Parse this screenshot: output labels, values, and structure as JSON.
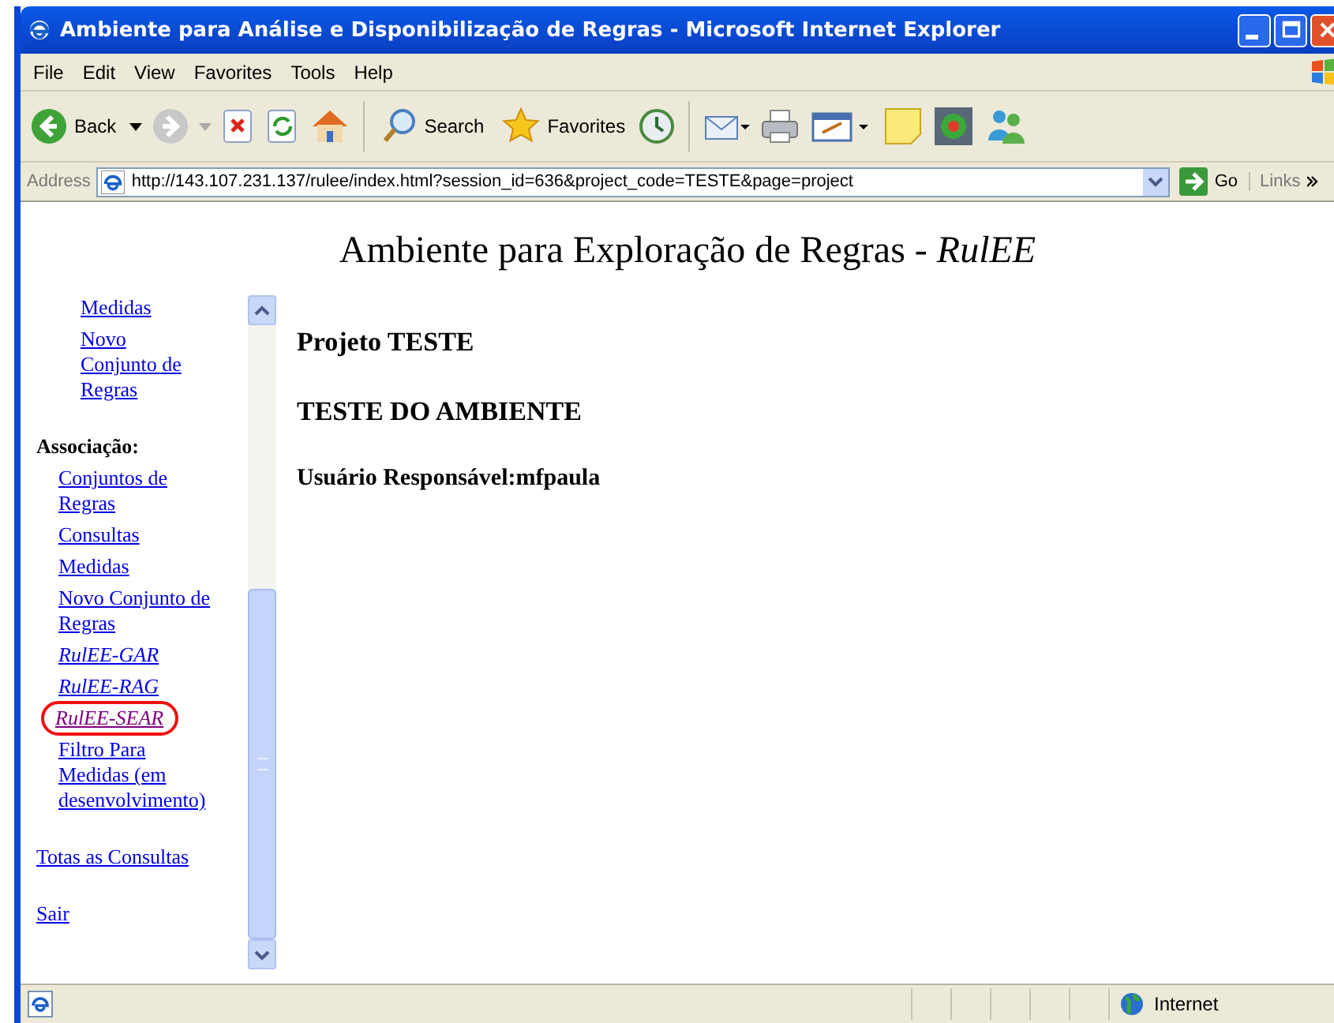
{
  "window": {
    "title": "Ambiente para Análise e Disponibilização de Regras - Microsoft Internet Explorer"
  },
  "menu": [
    {
      "label": "File"
    },
    {
      "label": "Edit"
    },
    {
      "label": "View"
    },
    {
      "label": "Favorites"
    },
    {
      "label": "Tools"
    },
    {
      "label": "Help"
    }
  ],
  "toolbar": {
    "back": "Back",
    "search": "Search",
    "favorites": "Favorites"
  },
  "address": {
    "label": "Address",
    "value": "http://143.107.231.137/rulee/index.html?session_id=636&project_code=TESTE&page=project",
    "go": "Go",
    "links": "Links"
  },
  "page_heading": "Ambiente para Exploração de Regras - *RulEE*",
  "sidebar": {
    "sections": [
      {
        "kind": "subgroup",
        "items": [
          {
            "label": "Medidas",
            "kind": "link",
            "visited": false,
            "circled": false
          },
          {
            "label": "Novo Conjunto de Regras",
            "kind": "link",
            "visited": false,
            "circled": false
          }
        ]
      },
      {
        "heading": "Associação:",
        "kind": "group",
        "items": [
          {
            "label": "Conjuntos de Regras",
            "kind": "link",
            "visited": false,
            "circled": false
          },
          {
            "label": "Consultas",
            "kind": "link",
            "visited": false,
            "circled": false
          },
          {
            "label": "Medidas",
            "kind": "link",
            "visited": false,
            "circled": false
          },
          {
            "label": "Novo Conjunto de Regras",
            "kind": "link",
            "visited": false,
            "circled": false
          },
          {
            "label": "RulEE-GAR",
            "kind": "italic_link",
            "visited": false,
            "circled": false
          },
          {
            "label": "RulEE-RAG",
            "kind": "italic_link",
            "visited": false,
            "circled": false
          },
          {
            "label": "RulEE-SEAR",
            "kind": "italic_link",
            "visited": true,
            "circled": true
          },
          {
            "label": "Filtro Para Medidas (em desenvolvimento)",
            "kind": "link",
            "visited": false,
            "circled": false
          }
        ]
      },
      {
        "kind": "single",
        "items": [
          {
            "label": "Totas as Consultas",
            "kind": "link",
            "visited": false,
            "circled": false
          }
        ]
      },
      {
        "kind": "single",
        "items": [
          {
            "label": "Sair",
            "kind": "link",
            "visited": false,
            "circled": false
          }
        ]
      }
    ]
  },
  "project": {
    "title": "Projeto TESTE",
    "subtitle": "TESTE DO AMBIENTE",
    "owner": "Usuário Responsável:mfpaula"
  },
  "status_bar": {
    "zone": "Internet"
  }
}
